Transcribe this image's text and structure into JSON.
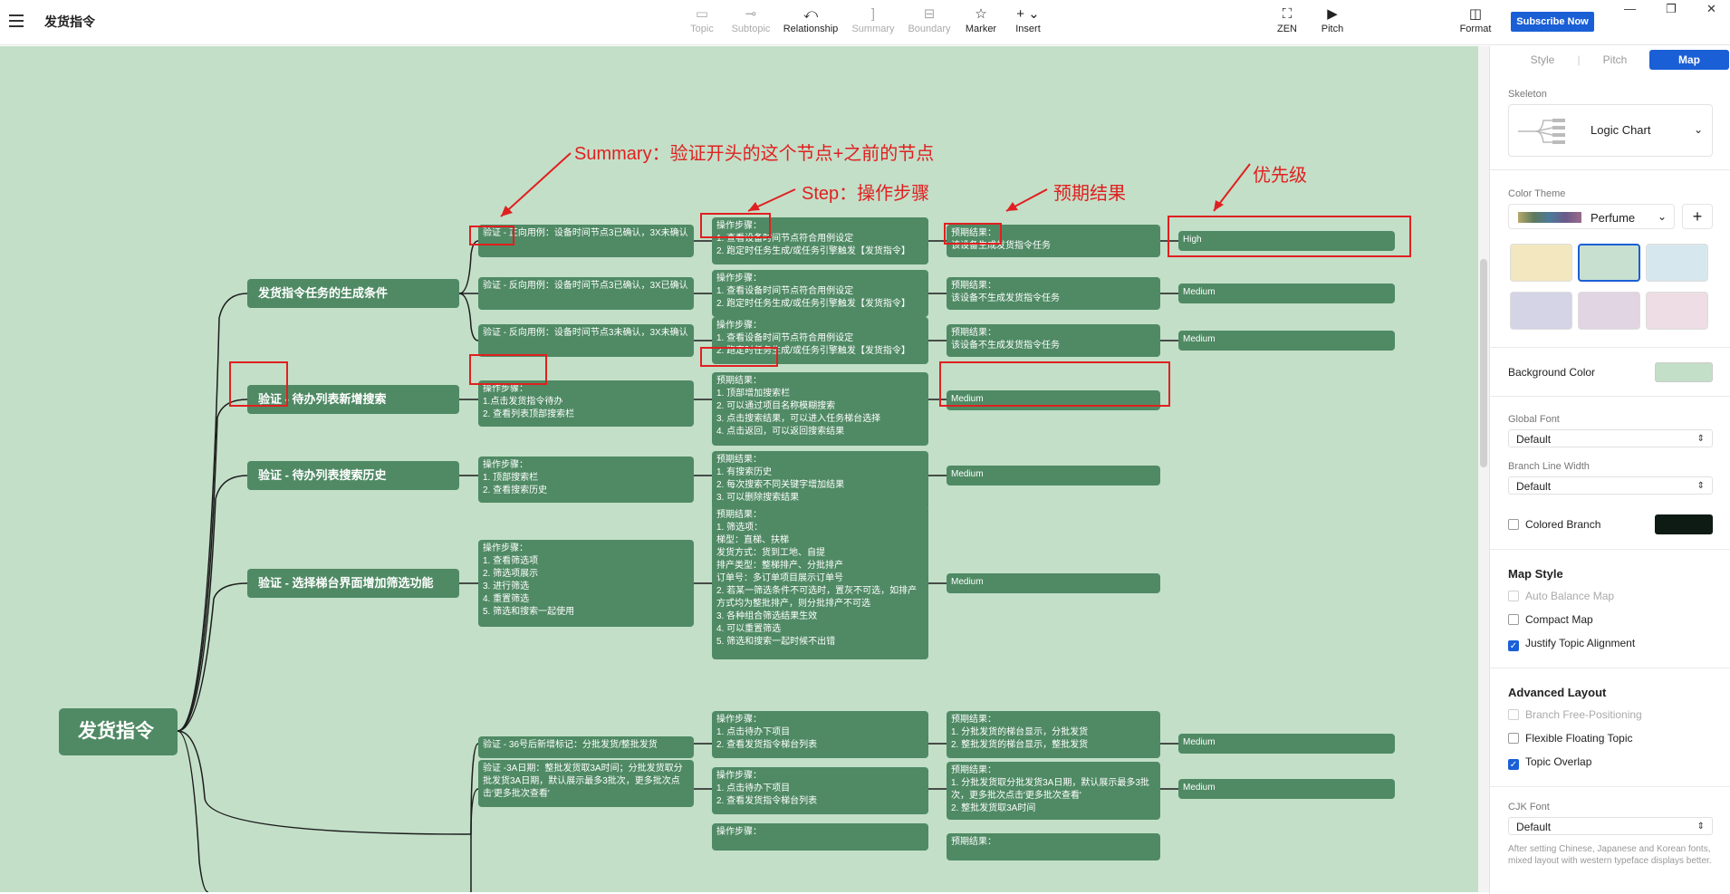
{
  "toolbar": {
    "title": "发货指令",
    "tools": [
      {
        "label": "Topic",
        "icon": "topic-icon",
        "enabled": false
      },
      {
        "label": "Subtopic",
        "icon": "subtopic-icon",
        "enabled": false
      },
      {
        "label": "Relationship",
        "icon": "relationship-icon",
        "enabled": true
      },
      {
        "label": "Summary",
        "icon": "summary-icon",
        "enabled": false
      },
      {
        "label": "Boundary",
        "icon": "boundary-icon",
        "enabled": false
      },
      {
        "label": "Marker",
        "icon": "star-icon",
        "enabled": true
      },
      {
        "label": "Insert",
        "icon": "plus-icon",
        "enabled": true
      }
    ],
    "zen_label": "ZEN",
    "pitch_label": "Pitch",
    "format_label": "Format",
    "subscribe_label": "Subscribe Now"
  },
  "map": {
    "root": "发货指令",
    "branches": [
      {
        "label": "发货指令任务的生成条件"
      },
      {
        "label": "验证 - 待办列表新增搜索"
      },
      {
        "label": "验证 - 待办列表搜索历史"
      },
      {
        "label": "验证 - 选择梯台界面增加筛选功能"
      }
    ],
    "cases": [
      "验证 - 正向用例：设备时间节点3已确认，3X未确认",
      "验证 - 反向用例：设备时间节点3已确认，3X已确认",
      "验证 - 反向用例：设备时间节点3未确认，3X未确认",
      "操作步骤：\n1.点击发货指令待办\n2. 查看列表顶部搜索栏",
      "操作步骤：\n1. 顶部搜索栏\n2. 查看搜索历史",
      "操作步骤：\n1. 查看筛选项\n2. 筛选项展示\n3. 进行筛选\n4. 重置筛选\n5. 筛选和搜索一起使用",
      "验证 - 36号后新增标记：分批发货/整批发货",
      "验证 -3A日期：整批发货取3A时间；分批发货取分批发货3A日期，默认展示最多3批次，更多批次点击'更多批次查看'"
    ],
    "steps": [
      "操作步骤：\n1. 查看设备时间节点符合用例设定\n2. 跑定时任务生成/或任务引擎触发【发货指令】",
      "操作步骤：\n1. 查看设备时间节点符合用例设定\n2. 跑定时任务生成/或任务引擎触发【发货指令】",
      "操作步骤：\n1. 查看设备时间节点符合用例设定\n2. 跑定时任务生成/或任务引擎触发【发货指令】",
      "预期结果：\n1. 顶部增加搜索栏\n2. 可以通过项目名称模糊搜索\n3. 点击搜索结果，可以进入任务梯台选择\n4. 点击返回，可以返回搜索结果",
      "预期结果：\n1. 有搜索历史\n2. 每次搜索不同关键字增加结果\n3. 可以删除搜索结果",
      "预期结果：\n1. 筛选项：\n梯型：直梯、扶梯\n发货方式：货到工地、自提\n排产类型：整梯排产、分批排产\n订单号：多订单项目展示订单号\n2. 若某一筛选条件不可选时，置灰不可选，如排产方式均为整批排产，则分批排产不可选\n3. 各种组合筛选结果生效\n4. 可以重置筛选\n5. 筛选和搜索一起时候不出错",
      "操作步骤：\n1. 点击待办下项目\n2. 查看发货指令梯台列表",
      "操作步骤：\n1. 点击待办下项目\n2. 查看发货指令梯台列表",
      "操作步骤："
    ],
    "results": [
      "预期结果：\n该设备生成发货指令任务",
      "预期结果：\n该设备不生成发货指令任务",
      "预期结果：\n该设备不生成发货指令任务",
      "Medium",
      "Medium",
      "Medium",
      "预期结果：\n1. 分批发货的梯台显示，分批发货\n2. 整批发货的梯台显示，整批发货",
      "预期结果：\n1. 分批发货取分批发货3A日期，默认展示最多3批次，更多批次点击'更多批次查看'\n2. 整批发货取3A时间",
      "预期结果："
    ],
    "priorities": [
      "High",
      "Medium",
      "Medium",
      "Medium",
      "Medium"
    ]
  },
  "annotations": {
    "summary": "Summary：验证开头的这个节点+之前的节点",
    "step": "Step：操作步骤",
    "expected": "预期结果",
    "priority": "优先级"
  },
  "panel": {
    "tabs": [
      "Style",
      "Pitch",
      "Map"
    ],
    "skeleton_label": "Skeleton",
    "skeleton_value": "Logic Chart",
    "color_theme_label": "Color Theme",
    "color_theme_value": "Perfume",
    "background_label": "Background Color",
    "background_color": "#c3dfc8",
    "global_font_label": "Global Font",
    "global_font_value": "Default",
    "branch_width_label": "Branch Line Width",
    "branch_width_value": "Default",
    "colored_branch_label": "Colored Branch",
    "map_style_title": "Map Style",
    "map_style_options": [
      {
        "label": "Auto Balance Map",
        "checked": false,
        "enabled": false
      },
      {
        "label": "Compact Map",
        "checked": false,
        "enabled": true
      },
      {
        "label": "Justify Topic Alignment",
        "checked": true,
        "enabled": true
      }
    ],
    "advanced_title": "Advanced Layout",
    "advanced_options": [
      {
        "label": "Branch Free-Positioning",
        "checked": false,
        "enabled": false
      },
      {
        "label": "Flexible Floating Topic",
        "checked": false,
        "enabled": true
      },
      {
        "label": "Topic Overlap",
        "checked": true,
        "enabled": true
      }
    ],
    "cjk_font_label": "CJK Font",
    "cjk_font_value": "Default",
    "cjk_note": "After setting Chinese, Japanese and Korean fonts, mixed layout with western typeface displays better."
  },
  "colors": {
    "canvas": "#c3dfc8",
    "node": "#4f8a64",
    "annotation": "#e02020",
    "accent": "#1a5fd6"
  }
}
